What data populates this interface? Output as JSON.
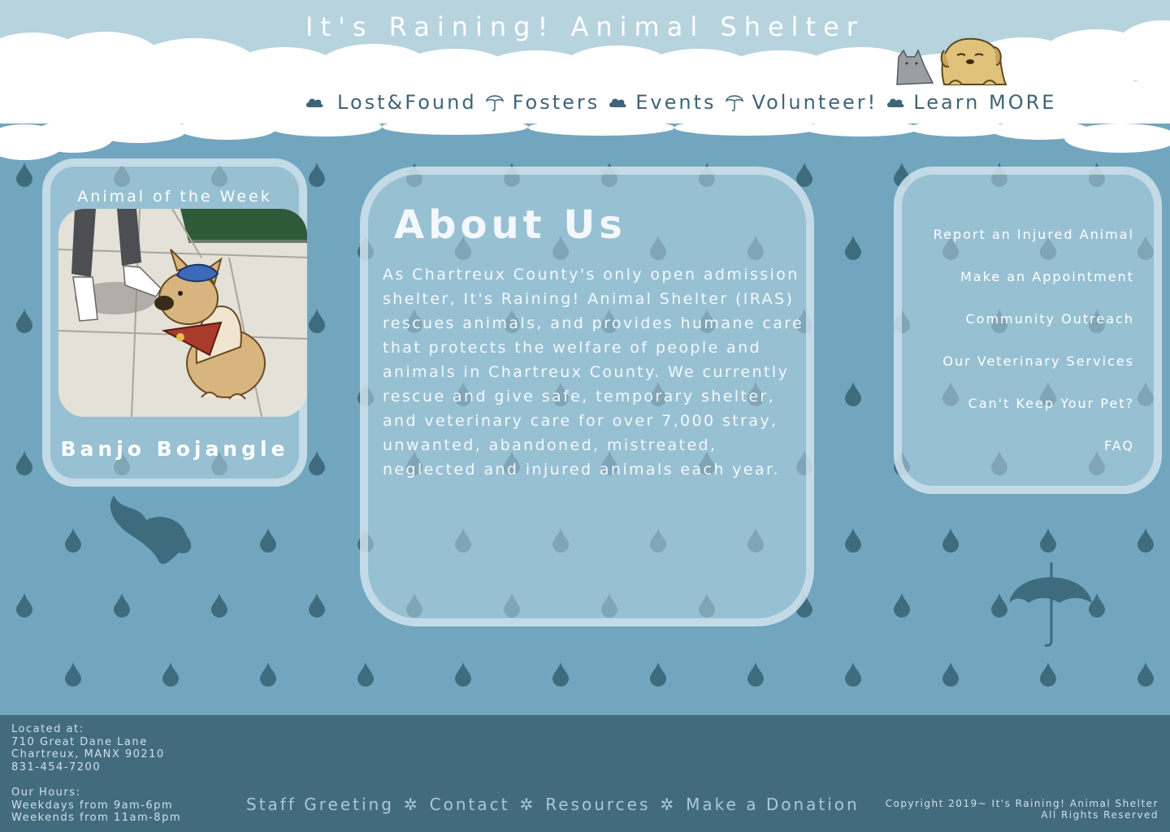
{
  "site": {
    "title": "It's Raining! Animal Shelter"
  },
  "colors": {
    "background": "#72a6bf",
    "raindrop": "#3f6b7e",
    "cloud": "#ffffff",
    "sky": "#b6d3de",
    "nav_text": "#3e6478",
    "footer": "#436b7e"
  },
  "nav": {
    "separators": [
      "cloud-icon",
      "umbrella-icon",
      "cloud-icon",
      "umbrella-icon",
      "cloud-icon"
    ],
    "items": [
      {
        "label": "Lost&Found"
      },
      {
        "label": "Fosters"
      },
      {
        "label": "Events"
      },
      {
        "label": "Volunteer!"
      },
      {
        "label": "Learn MORE"
      }
    ]
  },
  "animal_of_week": {
    "heading": "Animal of the Week",
    "name": "Banjo Bojangle"
  },
  "about": {
    "title": "About Us",
    "body": "As Chartreux County's only open admission shelter, It's Raining! Animal Shelter (IRAS) rescues animals, and provides humane care that protects the welfare of people and animals in Chartreux County. We currently rescue and give safe, temporary shelter, and veterinary care for over 7,000 stray, unwanted, abandoned, mistreated, neglected and injured animals each year."
  },
  "side_links": [
    {
      "label": "Report an Injured Animal"
    },
    {
      "label": "Make an Appointment"
    },
    {
      "label": "Community Outreach"
    },
    {
      "label": "Our Veterinary Services"
    },
    {
      "label": "Can't Keep Your Pet?"
    },
    {
      "label": "FAQ"
    }
  ],
  "footer": {
    "address": {
      "label": "Located at:",
      "street": "710 Great Dane Lane",
      "city": "Chartreux, MANX 90210",
      "phone": "831-454-7200"
    },
    "hours": {
      "label": "Our Hours:",
      "weekdays": "Weekdays from 9am-6pm",
      "weekends": "Weekends from 11am-8pm"
    },
    "links": [
      {
        "label": "Staff Greeting"
      },
      {
        "label": "Contact"
      },
      {
        "label": "Resources"
      },
      {
        "label": "Make a Donation"
      }
    ],
    "copyright_line1": "Copyright 2019~ It's Raining! Animal Shelter",
    "copyright_line2": "All Rights Reserved"
  }
}
